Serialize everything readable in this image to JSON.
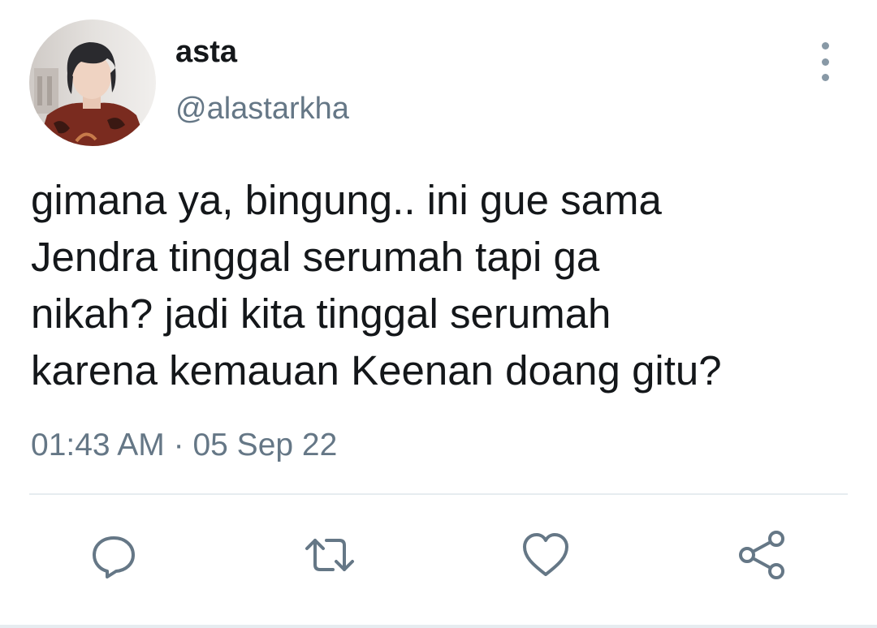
{
  "tweet": {
    "user": {
      "display_name": "asta",
      "handle": "@alastarkha",
      "avatar_icon": "profile-photo"
    },
    "text_lines": [
      "gimana ya, bingung.. ini gue sama",
      "Jendra tinggal serumah tapi ga",
      "nikah? jadi kita tinggal serumah",
      "karena kemauan Keenan doang gitu?"
    ],
    "time": "01:43 AM",
    "separator": "·",
    "date": "05 Sep 22"
  },
  "actions": [
    {
      "name": "reply",
      "icon": "speech-bubble-icon"
    },
    {
      "name": "retweet",
      "icon": "retweet-icon"
    },
    {
      "name": "like",
      "icon": "heart-icon"
    },
    {
      "name": "share",
      "icon": "share-icon"
    }
  ],
  "colors": {
    "text": "#14171a",
    "secondary": "#657786",
    "icon": "#657786",
    "divider": "#e6ecf0"
  }
}
